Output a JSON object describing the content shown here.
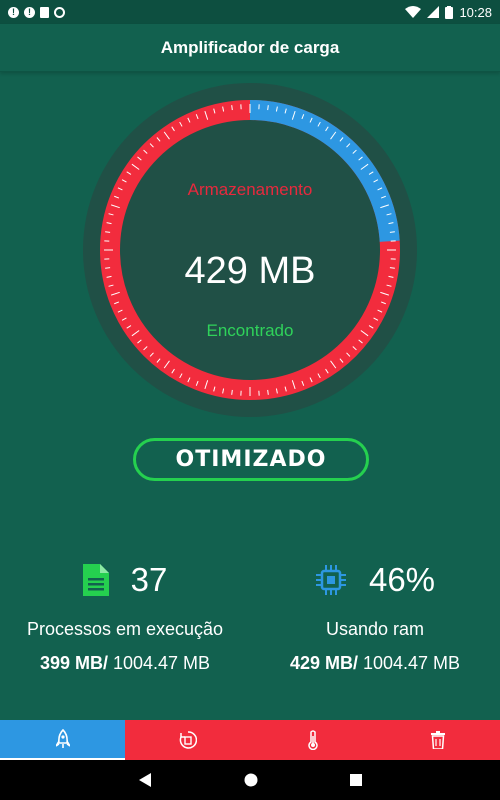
{
  "status_bar": {
    "time": "10:28"
  },
  "app_bar": {
    "title": "Amplificador de carga"
  },
  "gauge": {
    "label_top": "Armazenamento",
    "value": "429 MB",
    "label_bottom": "Encontrado",
    "used_fraction": 0.24,
    "colors": {
      "used": "#2d97e2",
      "free": "#f22c3d",
      "wave": "#2d97e2"
    }
  },
  "optimize_button": {
    "label": "OTIMIZADO"
  },
  "stats": {
    "processes": {
      "icon": "document-icon",
      "count": "37",
      "label": "Processos em execução",
      "used": "399 MB/",
      "total": " 1004.47 MB"
    },
    "ram": {
      "icon": "chip-icon",
      "percent": "46%",
      "label": "Usando ram",
      "used": "429 MB/",
      "total": " 1004.47 MB"
    }
  },
  "bottom_nav": {
    "items": [
      "rocket-icon",
      "cpu-refresh-icon",
      "thermometer-icon",
      "trash-icon"
    ]
  },
  "system_nav": {
    "items": [
      "back-icon",
      "home-icon",
      "recents-icon"
    ]
  }
}
